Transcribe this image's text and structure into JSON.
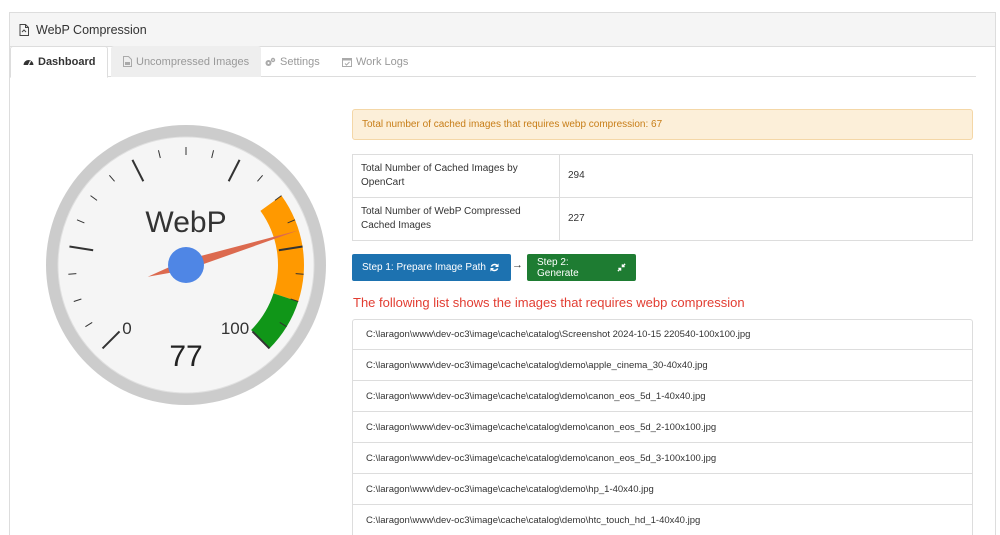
{
  "panel": {
    "title": "WebP Compression"
  },
  "tabs": [
    {
      "label": "Dashboard",
      "icon": "dashboard-icon",
      "active": true
    },
    {
      "label": "Uncompressed Images",
      "icon": "image-file-icon"
    },
    {
      "label": "Settings",
      "icon": "gears-icon"
    },
    {
      "label": "Work Logs",
      "icon": "calendar-icon"
    }
  ],
  "gauge": {
    "title": "WebP",
    "min_label": "0",
    "max_label": "100",
    "value": 77,
    "value_label": "77",
    "zones": [
      {
        "from": 70,
        "to": 90,
        "color": "#ff9900"
      },
      {
        "from": 90,
        "to": 100,
        "color": "#109618"
      }
    ]
  },
  "alert": {
    "text": "Total number of cached images that requires webp compression: 67"
  },
  "stats": [
    {
      "label": "Total Number of Cached Images by OpenCart",
      "value": "294"
    },
    {
      "label": "Total Number of WebP Compressed Cached Images",
      "value": "227"
    }
  ],
  "actions": {
    "step1_label": "Step 1: Prepare Image Path",
    "arrow": "→",
    "step2_label": "Step 2: Generate"
  },
  "list": {
    "title": "The following list shows the images that requires webp compression",
    "items": [
      "C:\\laragon\\www\\dev-oc3\\image\\cache\\catalog\\Screenshot 2024-10-15 220540-100x100.jpg",
      "C:\\laragon\\www\\dev-oc3\\image\\cache\\catalog\\demo\\apple_cinema_30-40x40.jpg",
      "C:\\laragon\\www\\dev-oc3\\image\\cache\\catalog\\demo\\canon_eos_5d_1-40x40.jpg",
      "C:\\laragon\\www\\dev-oc3\\image\\cache\\catalog\\demo\\canon_eos_5d_2-100x100.jpg",
      "C:\\laragon\\www\\dev-oc3\\image\\cache\\catalog\\demo\\canon_eos_5d_3-100x100.jpg",
      "C:\\laragon\\www\\dev-oc3\\image\\cache\\catalog\\demo\\hp_1-40x40.jpg",
      "C:\\laragon\\www\\dev-oc3\\image\\cache\\catalog\\demo\\htc_touch_hd_1-40x40.jpg"
    ]
  },
  "colors": {
    "primary": "#1d72b0",
    "success": "#1e7c32",
    "warning_bg": "#fcefd9",
    "warning_text": "#c77d17",
    "danger_text": "#e23d32",
    "needle": "#dc6a4f",
    "needle_hub": "#4f86e5"
  }
}
